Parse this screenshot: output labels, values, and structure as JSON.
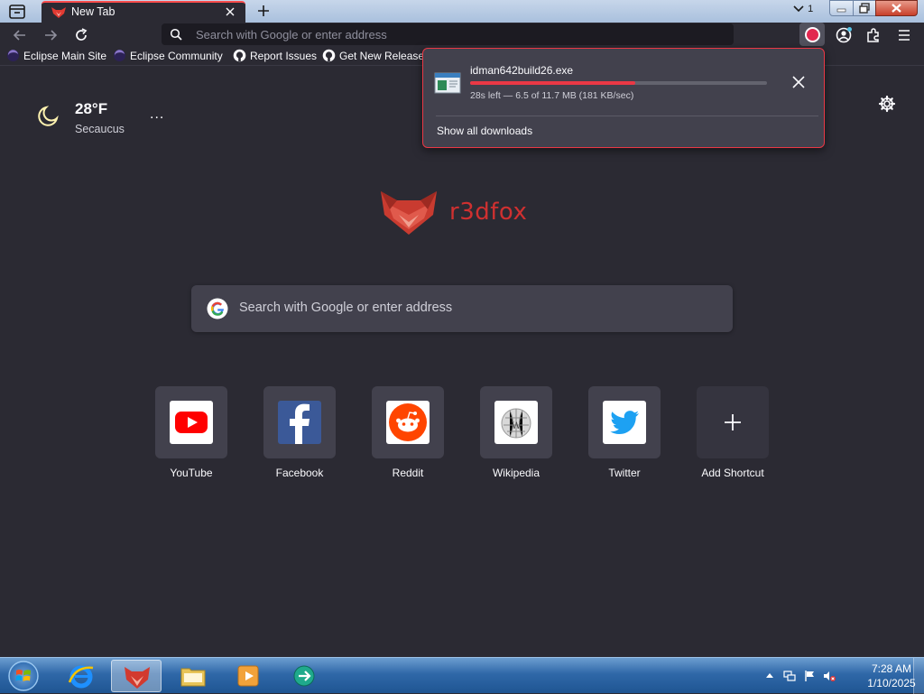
{
  "browser": {
    "tab": {
      "title": "New Tab"
    },
    "tab_count": "1",
    "urlbar": {
      "placeholder": "Search with Google or enter address"
    }
  },
  "bookmarks": [
    {
      "label": "Eclipse Main Site",
      "icon": "eclipse-icon"
    },
    {
      "label": "Eclipse Community",
      "icon": "eclipse-icon"
    },
    {
      "label": "Report Issues",
      "icon": "github-icon"
    },
    {
      "label": "Get New Releases",
      "icon": "github-icon"
    }
  ],
  "weather": {
    "temp": "28°F",
    "city": "Secaucus",
    "more": "..."
  },
  "brand": {
    "name": "r3dfox"
  },
  "search": {
    "placeholder": "Search with Google or enter address"
  },
  "shortcuts": [
    {
      "label": "YouTube",
      "icon": "youtube-icon"
    },
    {
      "label": "Facebook",
      "icon": "facebook-icon"
    },
    {
      "label": "Reddit",
      "icon": "reddit-icon"
    },
    {
      "label": "Wikipedia",
      "icon": "wikipedia-icon"
    },
    {
      "label": "Twitter",
      "icon": "twitter-icon"
    },
    {
      "label": "Add Shortcut",
      "icon": "plus-icon"
    }
  ],
  "download": {
    "filename": "idman642build26.exe",
    "status": "28s left — 6.5 of 11.7 MB (181 KB/sec)",
    "progress": 0.556,
    "show_all": "Show all downloads"
  },
  "taskbar": {
    "time": "7:28 AM",
    "date": "1/10/2025"
  },
  "colors": {
    "accent": "#ea3845",
    "background": "#2b2a33",
    "surface": "#42414d"
  }
}
